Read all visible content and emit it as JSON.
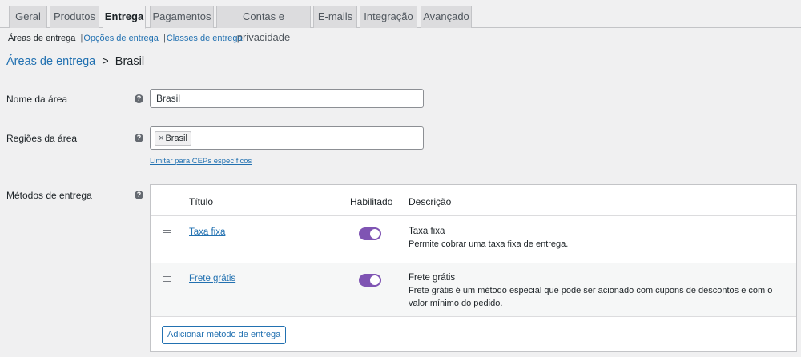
{
  "tabs": [
    "Geral",
    "Produtos",
    "Entrega",
    "Pagamentos",
    "Contas e privacidade",
    "E-mails",
    "Integração",
    "Avançado"
  ],
  "active_tab": "Entrega",
  "subsections": {
    "current": "Áreas de entrega",
    "options": "Opções de entrega",
    "classes": "Classes de entrega",
    "separator": "|"
  },
  "breadcrumb": {
    "parent": "Áreas de entrega",
    "arrow": ">",
    "current": "Brasil"
  },
  "zone_name": {
    "label": "Nome da área",
    "value": "Brasil"
  },
  "zone_regions": {
    "label": "Regiões da área",
    "chip": "Brasil",
    "chip_remove": "×",
    "limit_link": "Limitar para CEPs específicos"
  },
  "help_glyph": "?",
  "methods": {
    "label": "Métodos de entrega",
    "headers": {
      "title": "Título",
      "enabled": "Habilitado",
      "description": "Descrição"
    },
    "rows": [
      {
        "name": "Taxa fixa",
        "enabled": true,
        "desc_title": "Taxa fixa",
        "desc": "Permite cobrar uma taxa fixa de entrega."
      },
      {
        "name": "Frete grátis",
        "enabled": true,
        "desc_title": "Frete grátis",
        "desc": "Frete grátis é um método especial que pode ser acionado com cupons de descontos e com o valor mínimo do pedido."
      }
    ],
    "add_button": "Adicionar método de entrega"
  },
  "colors": {
    "link": "#2271b1",
    "toggle_on": "#7f54b3",
    "background": "#f0f0f1"
  }
}
